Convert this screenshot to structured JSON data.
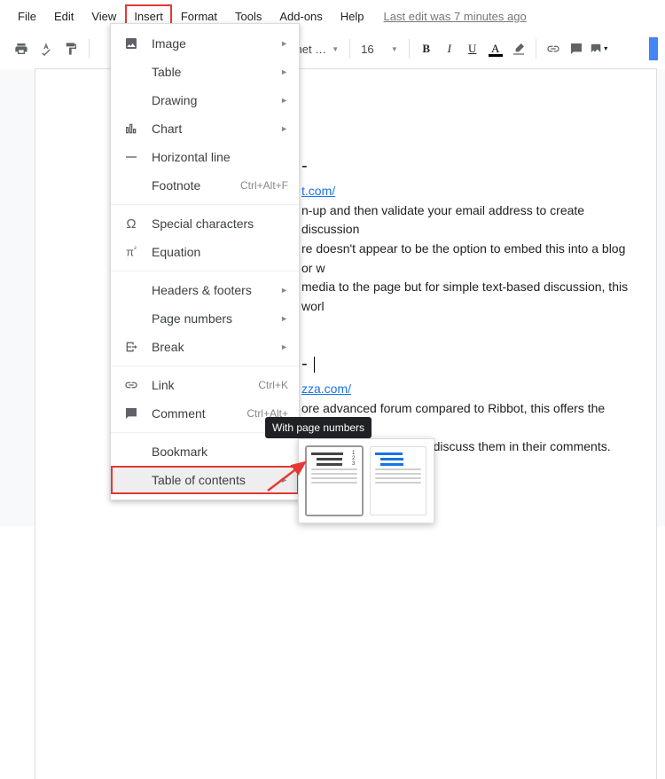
{
  "menubar": {
    "items": [
      "File",
      "Edit",
      "View",
      "Insert",
      "Format",
      "Tools",
      "Add-ons",
      "Help"
    ],
    "highlight_index": 3,
    "last_edit": "Last edit was 7 minutes ago"
  },
  "toolbar": {
    "font_name": "chet …",
    "font_size": "16"
  },
  "insert_menu": {
    "items": [
      {
        "icon": "image",
        "label": "Image",
        "sub": true
      },
      {
        "icon": "table",
        "label": "Table",
        "sub": true
      },
      {
        "icon": "drawing",
        "label": "Drawing",
        "sub": true
      },
      {
        "icon": "chart",
        "label": "Chart",
        "sub": true
      },
      {
        "icon": "hr",
        "label": "Horizontal line"
      },
      {
        "icon": "spacer",
        "label": "Footnote",
        "shortcut": "Ctrl+Alt+F"
      },
      {
        "divider": true
      },
      {
        "icon": "omega",
        "label": "Special characters"
      },
      {
        "icon": "pi",
        "label": "Equation"
      },
      {
        "divider": true
      },
      {
        "icon": "spacer",
        "label": "Headers & footers",
        "sub": true
      },
      {
        "icon": "spacer",
        "label": "Page numbers",
        "sub": true
      },
      {
        "icon": "break",
        "label": "Break",
        "sub": true
      },
      {
        "divider": true
      },
      {
        "icon": "link",
        "label": "Link",
        "shortcut": "Ctrl+K"
      },
      {
        "icon": "comment",
        "label": "Comment",
        "shortcut": "Ctrl+Alt+"
      },
      {
        "divider": true
      },
      {
        "icon": "spacer",
        "label": "Bookmark"
      },
      {
        "icon": "spacer",
        "label": "Table of contents",
        "sub": true,
        "highlight": true
      }
    ]
  },
  "toc_tooltip": "With page numbers",
  "doc": {
    "link1_text": "t.com/",
    "para1": "n-up and then validate your email address to create discussion ",
    "para1b": "re doesn't appear to be the option to embed this into a blog or w",
    "para1c": "media to the page but for simple text-based discussion, this worl",
    "link2_text": "zza.com/",
    "para2": "ore advanced forum compared to Ribbot, this offers the option t",
    "para2b": "so that the children can discuss them in their comments."
  }
}
